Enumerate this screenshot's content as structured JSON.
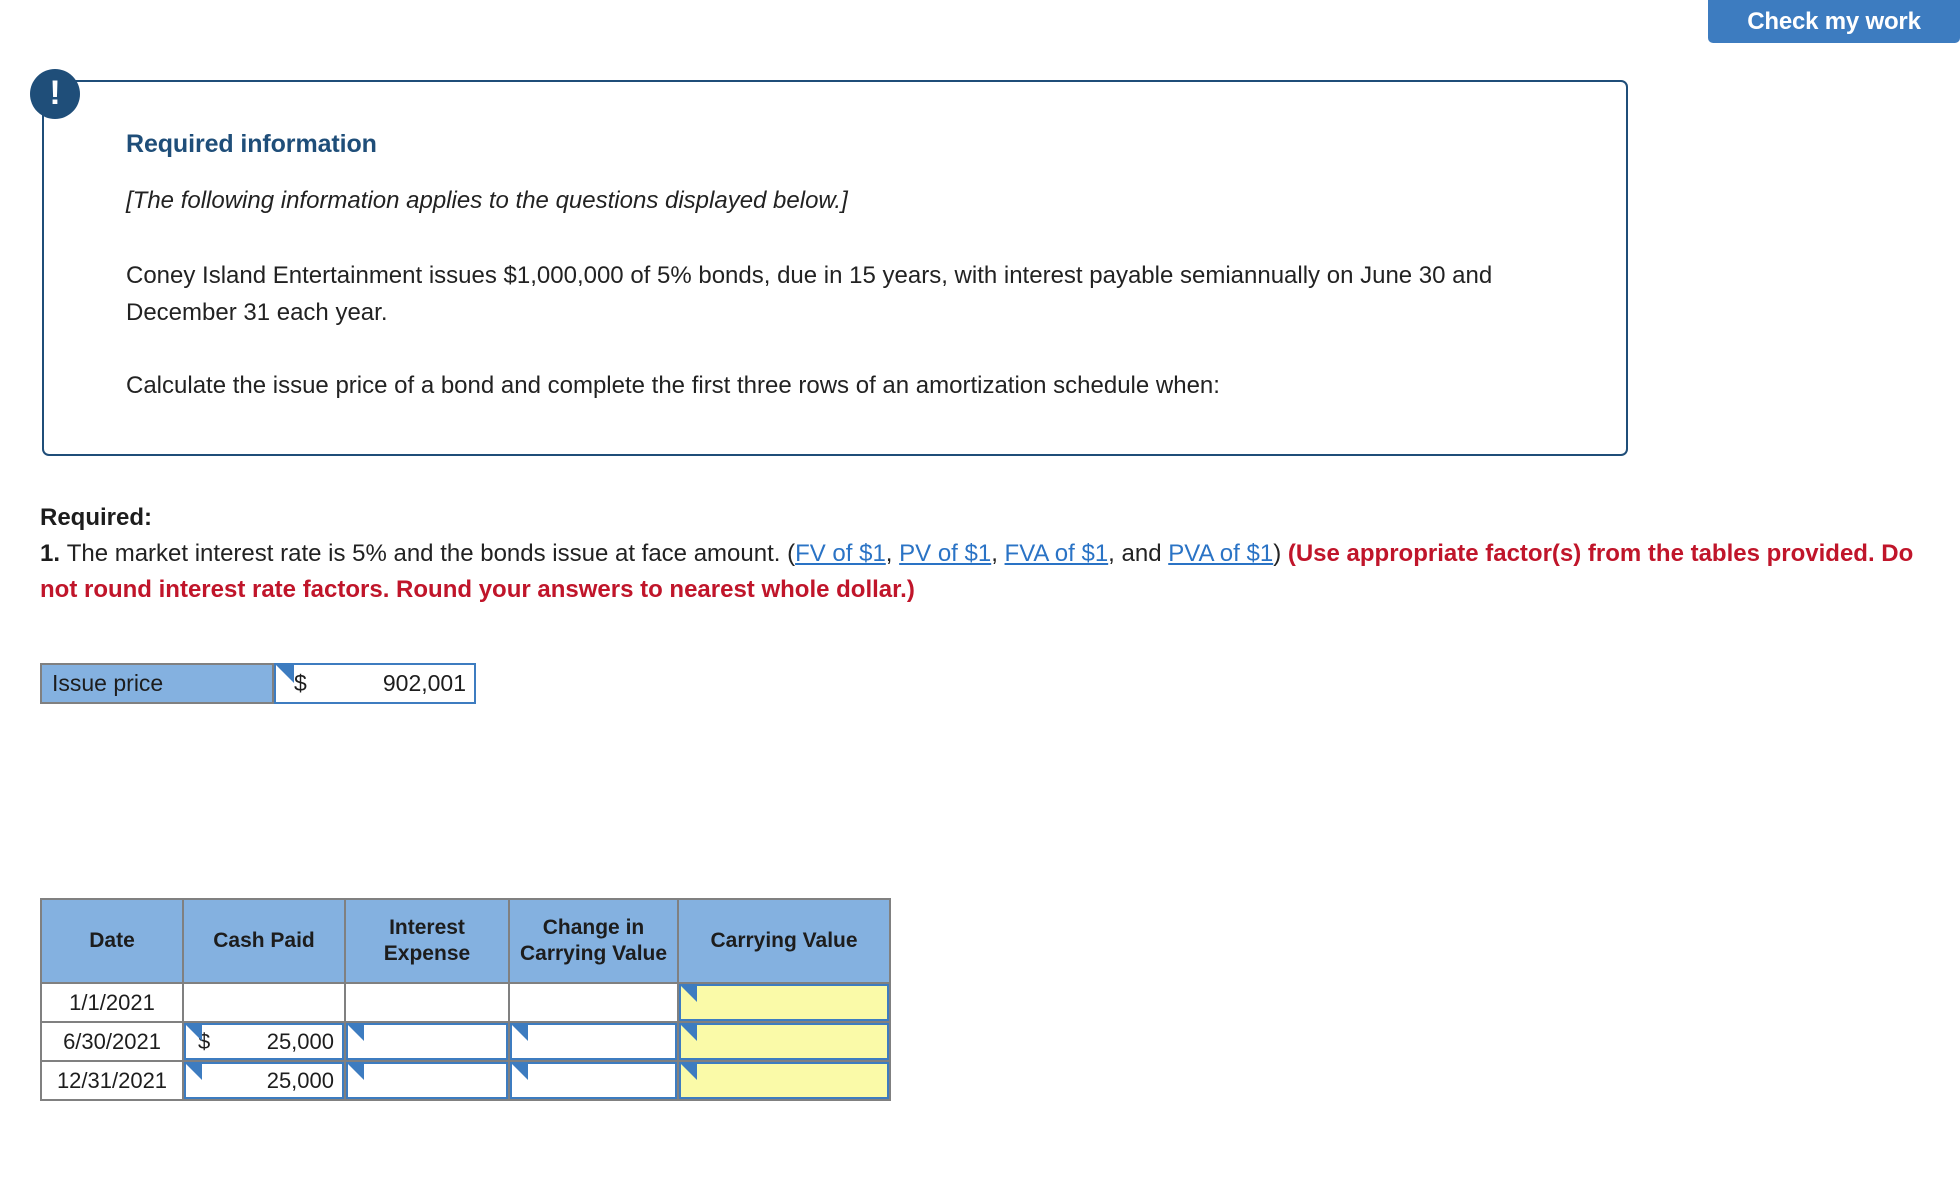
{
  "toolbar": {
    "check_my_work_label": "Check my work"
  },
  "callout": {
    "icon": "exclamation-icon",
    "icon_glyph": "!",
    "heading": "Required information",
    "italic_note": "[The following information applies to the questions displayed below.]",
    "paragraph_1": "Coney Island Entertainment issues $1,000,000 of 5% bonds, due in 15 years, with interest payable semiannually on June 30 and December 31 each year.",
    "paragraph_2": "Calculate the issue price of a bond and complete the first three rows of an amortization schedule when:",
    "border_color": "#1F4E79",
    "heading_color": "#1F4E79"
  },
  "required": {
    "label": "Required:",
    "number": "1.",
    "question_part_1": "The market interest rate is 5% and the bonds issue at face amount. (",
    "links": [
      {
        "label": "FV of $1"
      },
      {
        "label": "PV of $1"
      },
      {
        "label": "FVA of $1"
      },
      {
        "label": "PVA of $1"
      }
    ],
    "separator_1": ", ",
    "separator_2": ", ",
    "separator_3": ", and ",
    "closing_paren": ") ",
    "emphasis": "(Use appropriate factor(s) from the tables provided. Do not round interest rate factors. Round your answers to nearest whole dollar.)",
    "link_color": "#2A73C5",
    "emphasis_color": "#C0152A"
  },
  "issue_price": {
    "label": "Issue price",
    "currency": "$",
    "value": "902,001",
    "label_bg": "#84B1E0"
  },
  "amortization": {
    "columns": [
      "Date",
      "Cash Paid",
      "Interest Expense",
      "Change in Carrying Value",
      "Carrying Value"
    ],
    "header_bg": "#84B1E0",
    "highlight_bg": "#FAFAA8",
    "rows": [
      {
        "date": "1/1/2021",
        "cash_paid_currency": "",
        "cash_paid": "",
        "interest_expense": "",
        "change_in_carrying_value": "",
        "carrying_value": ""
      },
      {
        "date": "6/30/2021",
        "cash_paid_currency": "$",
        "cash_paid": "25,000",
        "interest_expense": "",
        "change_in_carrying_value": "",
        "carrying_value": ""
      },
      {
        "date": "12/31/2021",
        "cash_paid_currency": "",
        "cash_paid": "25,000",
        "interest_expense": "",
        "change_in_carrying_value": "",
        "carrying_value": ""
      }
    ]
  }
}
